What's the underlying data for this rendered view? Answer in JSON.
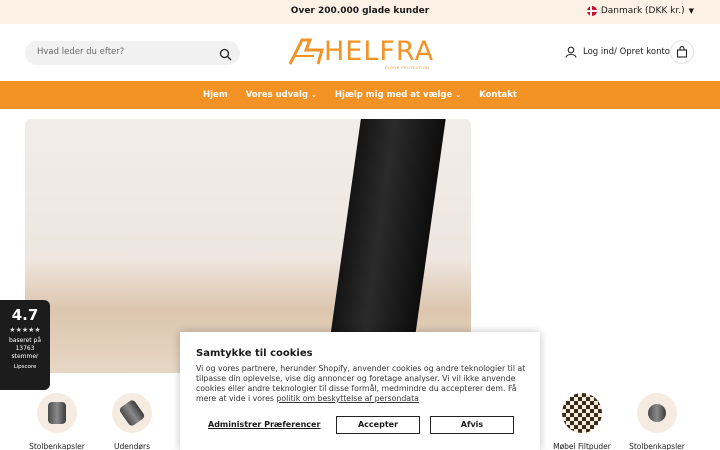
{
  "topbar": {
    "message": "Over 200.000 glade kunder",
    "language": "Danmark (DKK kr.)",
    "flag_icon": "denmark-flag-icon"
  },
  "header": {
    "search_placeholder": "Hvad leder du efter?",
    "logo_text": "HELFRA",
    "logo_tagline": "FLOOR PROTECTION",
    "account_label": "Log ind/ Opret konto",
    "icons": [
      "search-icon",
      "user-icon",
      "shopping-bag-icon"
    ]
  },
  "nav": {
    "items": [
      {
        "label": "Hjem",
        "has_dropdown": false
      },
      {
        "label": "Vores udvalg",
        "has_dropdown": true
      },
      {
        "label": "Hjælp mig med at vælge",
        "has_dropdown": true
      },
      {
        "label": "Kontakt",
        "has_dropdown": false
      }
    ]
  },
  "rating": {
    "score": "4.7",
    "stars": "★★★★★",
    "line1": "baseret på",
    "line2": "13763",
    "line3": "stemmer",
    "brand": "Lipscore"
  },
  "categories": [
    {
      "label": "Stolbenkapsler"
    },
    {
      "label": "Udendørs"
    },
    {
      "label": "Møbel Filtpuder"
    },
    {
      "label": "Stolbenkapsler"
    }
  ],
  "cookie": {
    "title": "Samtykke til cookies",
    "body": "Vi og vores partnere, herunder Shopify, anvender cookies og andre teknologier til at tilpasse din oplevelse, vise dig annoncer og foretage analyser. Vi vil ikke anvende cookies eller andre teknologier til disse formål, medmindre du accepterer dem. Få mere at vide i vores ",
    "link": "politik om beskyttelse af persondata",
    "preferences": "Administrer Præferencer",
    "accept": "Accepter",
    "reject": "Afvis"
  },
  "colors": {
    "accent": "#f39325",
    "topbar_bg": "#fdf1e6",
    "rating_bg": "#1c1c1c"
  }
}
